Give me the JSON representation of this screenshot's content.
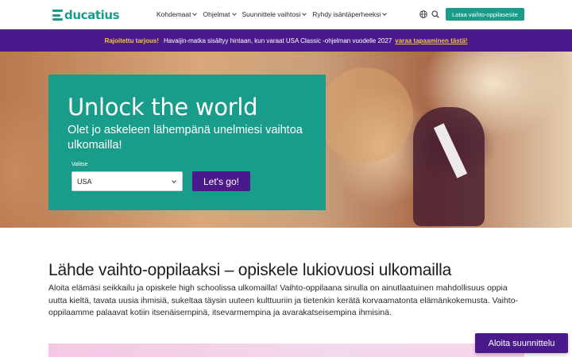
{
  "header": {
    "logo_text": "ducatius",
    "nav": [
      {
        "label": "Kohdemaat"
      },
      {
        "label": "Ohjelmat"
      },
      {
        "label": "Suunnittele vaihtosi"
      },
      {
        "label": "Ryhdy isäntäperheeksi"
      }
    ],
    "cta_label": "Lataa vaihto-oppilasesite",
    "icons": [
      "globe-icon",
      "search-icon"
    ]
  },
  "promo": {
    "strong": "Rajoitettu tarjous!",
    "text": "Havaijin-matka sisältyy hintaan, kun varaat USA Classic -ohjelman vuodelle 2027",
    "link": "varaa tapaaminen tästä!"
  },
  "hero": {
    "title": "Unlock the world",
    "subtitle": "Olet jo askeleen lähempänä unelmiesi vaihtoa ulkomailla!",
    "select_label": "Valitse",
    "select_value": "USA",
    "go_label": "Let's go!"
  },
  "main": {
    "title": "Lähde vaihto-oppilaaksi – opiskele lukiovuosi ulkomailla",
    "body": "Aloita elämäsi seikkailu ja opiskele high schoolissa ulkomailla! Vaihto-oppilaana sinulla on ainutlaatuinen mahdollisuus oppia uutta kieltä, tavata uusia ihmisiä, sukeltaa täysin uuteen kulttuuriin ja tietenkin kerätä korvaamatonta elämänkokemusta. Vaihto-oppilaamme palaavat kotiin itsenäisempinä, itsevarmempina ja avarakatseisempina ihmisinä."
  },
  "floating_button": {
    "label": "Aloita suunnittelu"
  },
  "colors": {
    "brand_teal": "#1a9c8a",
    "brand_purple": "#4a1a8c",
    "promo_accent": "#f5c542"
  }
}
